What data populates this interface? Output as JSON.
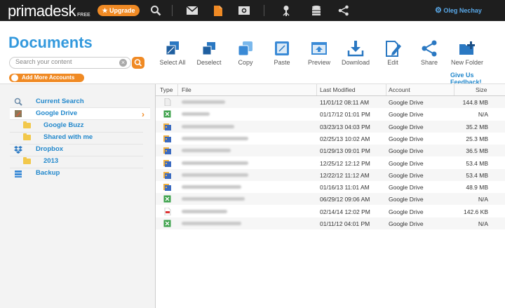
{
  "app": {
    "logo_text": "primadesk",
    "logo_tag": "FREE",
    "upgrade_label": "Upgrade",
    "user_name": "Oleg Nechay"
  },
  "top_icons": [
    "search-icon",
    "mail-icon",
    "document-icon",
    "photo-icon",
    "music-icon",
    "database-icon",
    "share-icon"
  ],
  "page": {
    "title": "Documents",
    "search_placeholder": "Search your content",
    "add_accounts_label": "Add More Accounts",
    "feedback_label": "Give Us Feedback!"
  },
  "toolbar": {
    "select_all": "Select All",
    "deselect": "Deselect",
    "copy": "Copy",
    "paste": "Paste",
    "preview": "Preview",
    "download": "Download",
    "edit": "Edit",
    "share": "Share",
    "new_folder": "New Folder"
  },
  "sidebar": {
    "current_search": "Current Search",
    "google_drive": "Google Drive",
    "google_buzz": "Google Buzz",
    "shared_with_me": "Shared with me",
    "dropbox": "Dropbox",
    "year_2013": "2013",
    "backup": "Backup"
  },
  "table": {
    "headers": {
      "type": "Type",
      "file": "File",
      "modified": "Last Modified",
      "account": "Account",
      "size": "Size"
    },
    "rows": [
      {
        "type": "generic",
        "modified": "11/01/12 08:11 AM",
        "account": "Google Drive",
        "size": "144.8 MB"
      },
      {
        "type": "spreadsheet",
        "modified": "01/17/12 01:01 PM",
        "account": "Google Drive",
        "size": "N/A"
      },
      {
        "type": "video",
        "modified": "03/23/13 04:03 PM",
        "account": "Google Drive",
        "size": "35.2 MB"
      },
      {
        "type": "video",
        "modified": "02/25/13 10:02 AM",
        "account": "Google Drive",
        "size": "25.3 MB"
      },
      {
        "type": "video",
        "modified": "01/29/13 09:01 PM",
        "account": "Google Drive",
        "size": "36.5 MB"
      },
      {
        "type": "video",
        "modified": "12/25/12 12:12 PM",
        "account": "Google Drive",
        "size": "53.4 MB"
      },
      {
        "type": "video",
        "modified": "12/22/12 11:12 AM",
        "account": "Google Drive",
        "size": "53.4 MB"
      },
      {
        "type": "video",
        "modified": "01/16/13 11:01 AM",
        "account": "Google Drive",
        "size": "48.9 MB"
      },
      {
        "type": "spreadsheet",
        "modified": "06/29/12 09:06 AM",
        "account": "Google Drive",
        "size": "N/A"
      },
      {
        "type": "pdf",
        "modified": "02/14/14 12:02 PM",
        "account": "Google Drive",
        "size": "142.6 KB"
      },
      {
        "type": "spreadsheet",
        "modified": "01/11/12 04:01 PM",
        "account": "Google Drive",
        "size": "N/A"
      }
    ]
  },
  "colors": {
    "accent": "#3399dd",
    "orange": "#f08a24",
    "topbar": "#1e1e1e",
    "toolbar_icon": "#2a78c2"
  }
}
